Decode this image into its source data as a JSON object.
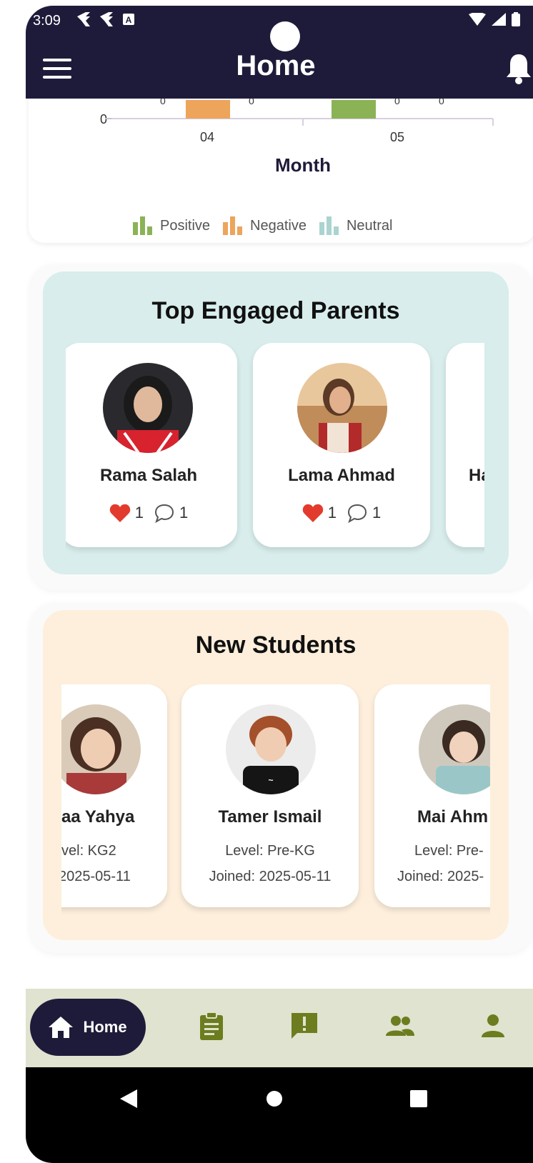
{
  "status_bar": {
    "time": "3:09"
  },
  "appbar": {
    "title": "Home"
  },
  "chart_data": {
    "type": "bar",
    "categories": [
      "04",
      "05"
    ],
    "xlabel": "Month",
    "y_tick_visible": "0",
    "series": [
      {
        "name": "Positive",
        "color": "#8bb356"
      },
      {
        "name": "Negative",
        "color": "#eda45b"
      },
      {
        "name": "Neutral",
        "color": "#a9d4d0"
      }
    ],
    "point_labels": [
      "0",
      "0",
      "0",
      "0",
      "0"
    ]
  },
  "top_parents": {
    "title": "Top Engaged Parents",
    "items": [
      {
        "name": "Rama Salah",
        "likes": "1",
        "comments": "1"
      },
      {
        "name": "Lama Ahmad",
        "likes": "1",
        "comments": "1"
      },
      {
        "name": "Ha"
      }
    ]
  },
  "new_students": {
    "title": "New Students",
    "items": [
      {
        "name": "aa Yahya",
        "level": "vel: KG2",
        "joined": " 2025-05-11"
      },
      {
        "name": "Tamer Ismail",
        "level": "Level: Pre-KG",
        "joined": "Joined: 2025-05-11"
      },
      {
        "name": "Mai Ahm",
        "level": "Level: Pre-",
        "joined": "Joined: 2025-"
      }
    ]
  },
  "bottom_nav": {
    "home_label": "Home"
  },
  "colors": {
    "primary": "#1e1b3a",
    "parents_bg": "#d8edec",
    "students_bg": "#fdefdc",
    "nav_bg": "#dfe3cf",
    "nav_icon": "#6b7d1e"
  }
}
